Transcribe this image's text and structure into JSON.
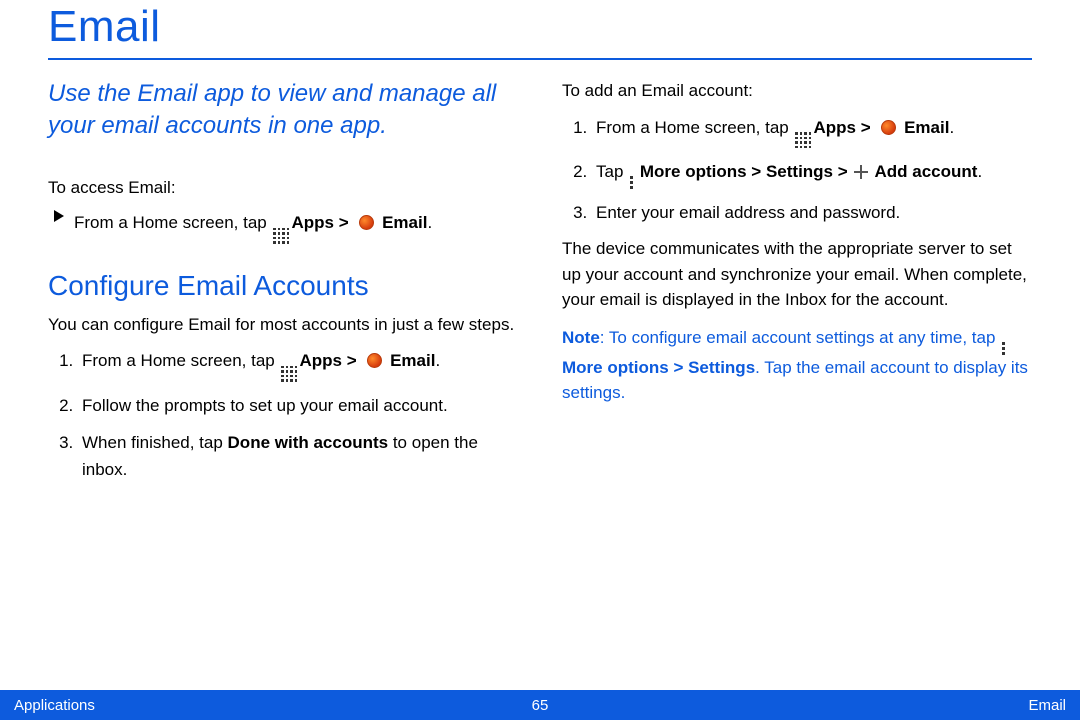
{
  "title": "Email",
  "intro": "Use the Email app to view and manage all your email accounts in one app.",
  "left": {
    "access_label": "To access Email:",
    "access_step_prefix": "From a Home screen, tap ",
    "apps_label": "Apps > ",
    "email_label": " Email",
    "subhead": "Configure Email Accounts",
    "config_intro": "You can configure Email for most accounts in just a few steps.",
    "steps": {
      "s1_prefix": "From a Home screen, tap ",
      "s1_apps": "Apps > ",
      "s1_email": " Email",
      "s2": "Follow the prompts to set up your email account.",
      "s3_prefix": "When finished, tap ",
      "s3_bold": "Done with accounts",
      "s3_suffix": " to open the inbox."
    }
  },
  "right": {
    "add_label": "To add an Email account:",
    "steps": {
      "s1_prefix": "From a Home screen, tap ",
      "s1_apps": "Apps > ",
      "s1_email": " Email",
      "s2_prefix": "Tap ",
      "s2_more": " More options > Settings > ",
      "s2_add": " Add account",
      "s3": "Enter your email address and password."
    },
    "para": "The device communicates with the appropriate server to set up your account and synchronize your email. When complete, your email is displayed in the Inbox for the account.",
    "note_label": "Note",
    "note_text1": ": To configure email account settings at any time, tap ",
    "note_bold": "More options > Settings",
    "note_text2": ". Tap the email account to display its settings."
  },
  "footer": {
    "left": "Applications",
    "center": "65",
    "right": "Email"
  }
}
